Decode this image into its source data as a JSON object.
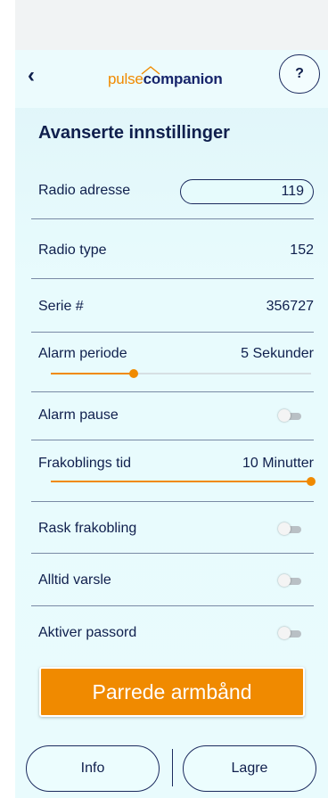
{
  "header": {
    "back_icon": "chevron-left-icon",
    "logo_part1": "pulse",
    "logo_part2": "companion",
    "help_label": "?"
  },
  "title": "Avanserte innstillinger",
  "settings": {
    "radio_address": {
      "label": "Radio adresse",
      "value": "119"
    },
    "radio_type": {
      "label": "Radio type",
      "value": "152"
    },
    "serial": {
      "label": "Serie #",
      "value": "356727"
    },
    "alarm_period": {
      "label": "Alarm periode",
      "value": "5 Sekunder",
      "slider_fraction": 0.32
    },
    "alarm_pause": {
      "label": "Alarm pause",
      "on": false
    },
    "disconnect_time": {
      "label": "Frakoblings tid",
      "value": "10 Minutter",
      "slider_fraction": 1.0
    },
    "quick_disconnect": {
      "label": "Rask frakobling",
      "on": false
    },
    "always_notify": {
      "label": "Alltid varsle",
      "on": false
    },
    "enable_password": {
      "label": "Aktiver passord",
      "on": false
    }
  },
  "buttons": {
    "paired": "Parrede armbånd",
    "info": "Info",
    "save": "Lagre"
  },
  "colors": {
    "accent": "#f08a00",
    "navy": "#0f1f4d",
    "background": "#e8fbfd"
  }
}
